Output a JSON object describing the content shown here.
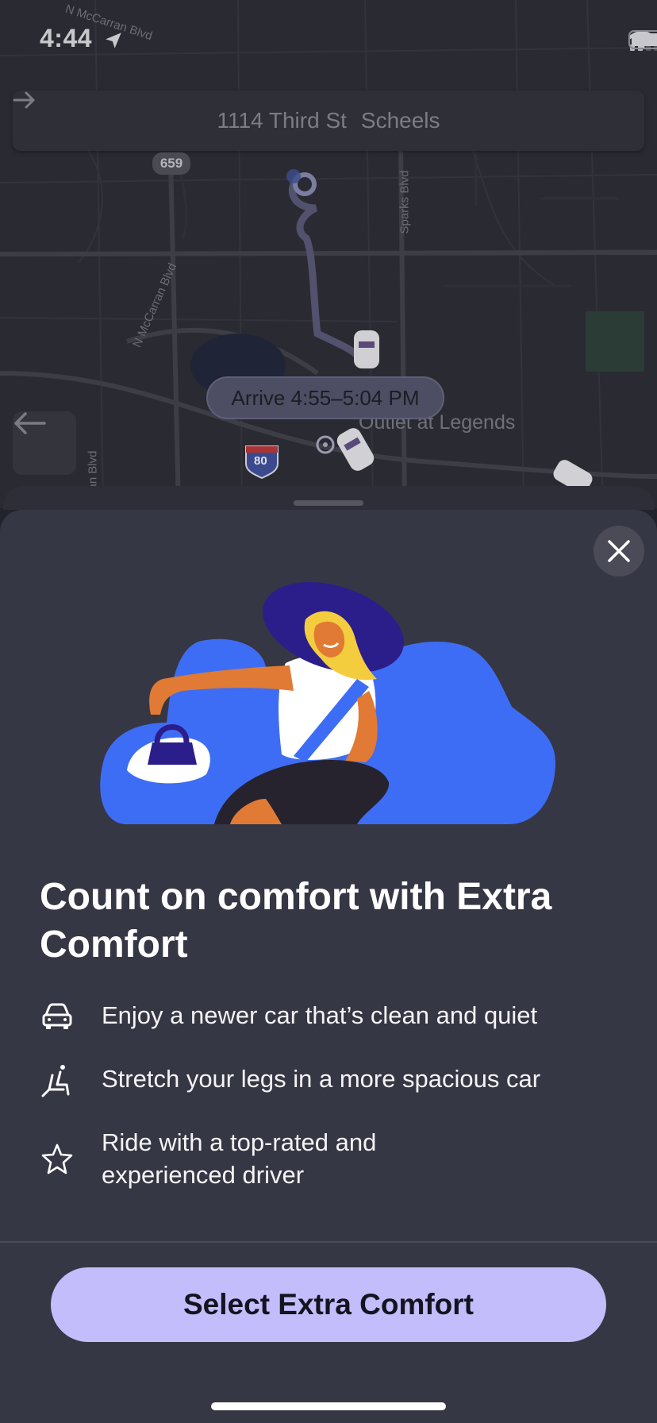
{
  "status_bar": {
    "time": "4:44",
    "icons": [
      "location-arrow-icon",
      "cellular-signal-icon",
      "wifi-icon",
      "battery-icon"
    ]
  },
  "route": {
    "origin": "1114 Third St",
    "destination": "Scheels"
  },
  "map": {
    "road_labels": [
      "N McCarran Blvd",
      "N McCarran Blvd",
      "Sparks Blvd",
      "an Blvd"
    ],
    "place_label": "Outlet at Legends",
    "highway_shield": "659",
    "interstate_shield": "80",
    "eta_pill": "Arrive 4:55–5:04 PM"
  },
  "sheet": {
    "headline": "Count on comfort with Extra Comfort",
    "features": [
      {
        "icon": "car-icon",
        "text": "Enjoy a newer car that’s clean and quiet"
      },
      {
        "icon": "seat-recline-icon",
        "text": "Stretch your legs in a more spacious car"
      },
      {
        "icon": "star-icon",
        "text": "Ride with a top-rated and experienced driver"
      }
    ],
    "cta_label": "Select Extra Comfort"
  },
  "colors": {
    "sheet_background": "#363744",
    "cta_background": "#c3bdfb",
    "illustration_blue": "#3e6df5",
    "hat_purple": "#2c1e8a"
  }
}
